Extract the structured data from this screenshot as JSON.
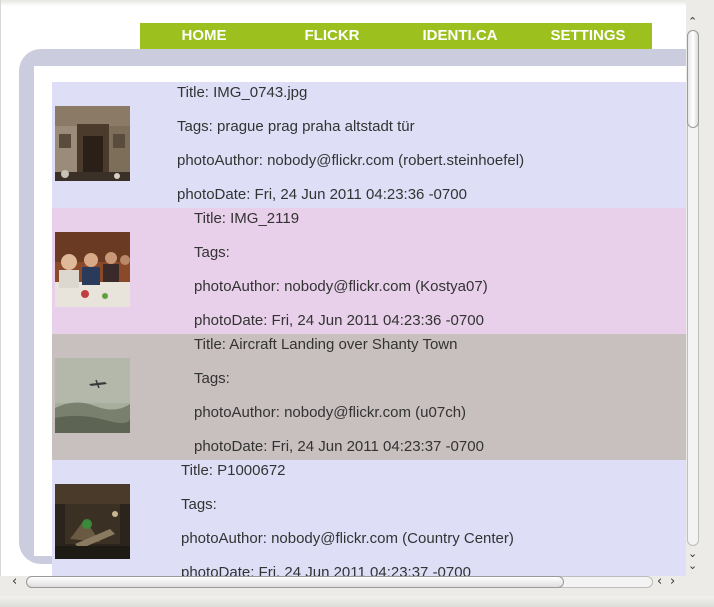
{
  "nav": {
    "items": [
      {
        "label": "HOME"
      },
      {
        "label": "FLICKR"
      },
      {
        "label": "IDENTI.CA"
      },
      {
        "label": "SETTINGS"
      }
    ]
  },
  "feed": {
    "entries": [
      {
        "title": "Title: IMG_0743.jpg",
        "tags": "Tags: prague prag praha altstadt tür",
        "author": "photoAuthor: nobody@flickr.com (robert.steinhoefel)",
        "date": "photoDate: Fri, 24 Jun 2011 04:23:36 -0700"
      },
      {
        "title": "Title: IMG_2119",
        "tags": "Tags:",
        "author": "photoAuthor: nobody@flickr.com (Kostya07)",
        "date": "photoDate: Fri, 24 Jun 2011 04:23:36 -0700"
      },
      {
        "title": "Title: Aircraft Landing over Shanty Town",
        "tags": "Tags:",
        "author": "photoAuthor: nobody@flickr.com (u07ch)",
        "date": "photoDate: Fri, 24 Jun 2011 04:23:37 -0700"
      },
      {
        "title": "Title: P1000672",
        "tags": "Tags:",
        "author": "photoAuthor: nobody@flickr.com (Country Center)",
        "date": "photoDate: Fri, 24 Jun 2011 04:23:37 -0700"
      }
    ]
  },
  "scroll": {
    "up_icon": "chevron-up-icon",
    "down_icon": "chevron-down-icon",
    "left_icon": "chevron-left-icon",
    "right_icon": "chevron-right-icon"
  },
  "colors": {
    "nav_bg": "#9cc11f",
    "frame": "#ccccdf",
    "row_blue": "#dedff7",
    "row_pink": "#e8cfea",
    "row_gray": "#c8bfbf"
  }
}
